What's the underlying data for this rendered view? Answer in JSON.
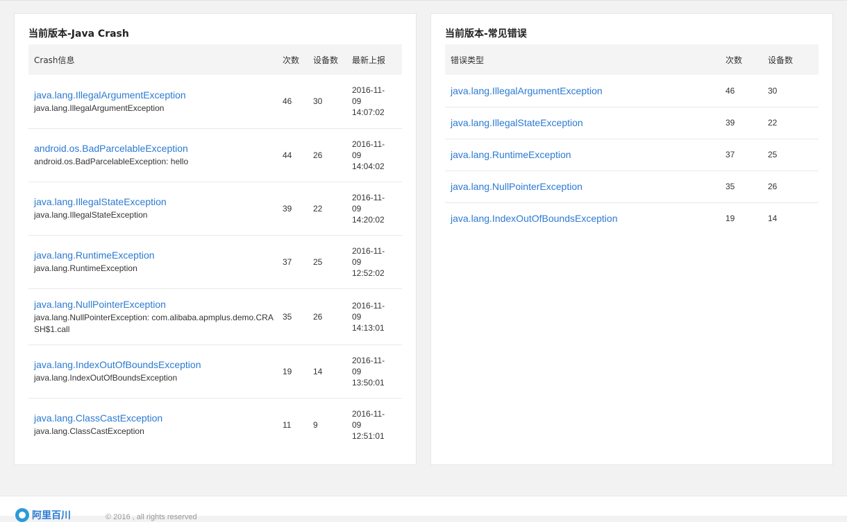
{
  "left_panel": {
    "title": "当前版本-Java Crash",
    "headers": [
      "Crash信息",
      "次数",
      "设备数",
      "最新上报"
    ],
    "rows": [
      {
        "name": "java.lang.IllegalArgumentException",
        "desc": "java.lang.IllegalArgumentException",
        "count": "46",
        "devices": "30",
        "date": "2016-11-",
        "day": "09",
        "time": "14:07:02"
      },
      {
        "name": "android.os.BadParcelableException",
        "desc": "android.os.BadParcelableException: hello",
        "count": "44",
        "devices": "26",
        "date": "2016-11-",
        "day": "09",
        "time": "14:04:02"
      },
      {
        "name": "java.lang.IllegalStateException",
        "desc": "java.lang.IllegalStateException",
        "count": "39",
        "devices": "22",
        "date": "2016-11-",
        "day": "09",
        "time": "14:20:02"
      },
      {
        "name": "java.lang.RuntimeException",
        "desc": "java.lang.RuntimeException",
        "count": "37",
        "devices": "25",
        "date": "2016-11-",
        "day": "09",
        "time": "12:52:02"
      },
      {
        "name": "java.lang.NullPointerException",
        "desc": "java.lang.NullPointerException: com.alibaba.apmplus.demo.CRA",
        "desc2": "SH$1.call",
        "count": "35",
        "devices": "26",
        "date": "2016-11-",
        "day": "09",
        "time": "14:13:01"
      },
      {
        "name": "java.lang.IndexOutOfBoundsException",
        "desc": "java.lang.IndexOutOfBoundsException",
        "count": "19",
        "devices": "14",
        "date": "2016-11-",
        "day": "09",
        "time": "13:50:01"
      },
      {
        "name": "java.lang.ClassCastException",
        "desc": "java.lang.ClassCastException",
        "count": "11",
        "devices": "9",
        "date": "2016-11-",
        "day": "09",
        "time": "12:51:01"
      }
    ]
  },
  "right_panel": {
    "title": "当前版本-常见错误",
    "headers": [
      "错误类型",
      "次数",
      "设备数"
    ],
    "rows": [
      {
        "name": "java.lang.IllegalArgumentException",
        "count": "46",
        "devices": "30"
      },
      {
        "name": "java.lang.IllegalStateException",
        "count": "39",
        "devices": "22"
      },
      {
        "name": "java.lang.RuntimeException",
        "count": "37",
        "devices": "25"
      },
      {
        "name": "java.lang.NullPointerException",
        "count": "35",
        "devices": "26"
      },
      {
        "name": "java.lang.IndexOutOfBoundsException",
        "count": "19",
        "devices": "14"
      }
    ]
  },
  "footer": {
    "logo_text": "阿里百川",
    "copyright": "© 2016 , all rights reserved"
  },
  "colors": {
    "link": "#2a7ad2",
    "header_bg": "#f4f4f4",
    "page_bg": "#f2f2f2"
  }
}
